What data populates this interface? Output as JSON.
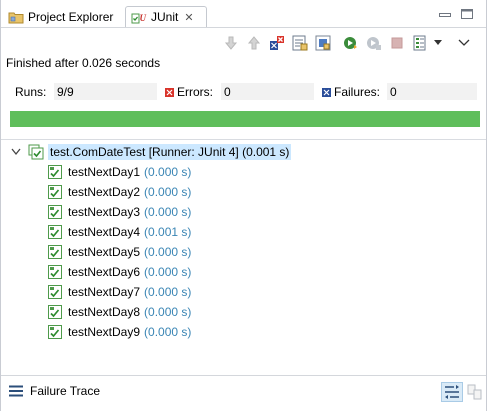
{
  "tabs": [
    {
      "label": "Project Explorer",
      "icon": "project-explorer-icon"
    },
    {
      "label": "JUnit",
      "icon": "junit-icon",
      "active": true
    }
  ],
  "toolbar": {
    "items": [
      "next-failure-icon",
      "previous-failure-icon",
      "show-failures-only-icon",
      "scroll-lock-icon",
      "show-skipped-icon",
      "rerun-test-icon",
      "rerun-failed-first-icon",
      "stop-icon",
      "test-run-history-icon",
      "view-menu-icon"
    ]
  },
  "status": "Finished after 0.026 seconds",
  "counters": {
    "runs_label": "Runs:",
    "runs_value": "9/9",
    "errors_label": "Errors:",
    "errors_value": "0",
    "failures_label": "Failures:",
    "failures_value": "0"
  },
  "progress": {
    "fraction": 1.0,
    "color": "#5fbe5b"
  },
  "tree": {
    "root": {
      "name": "test.ComDateTest [Runner: JUnit 4] (0.001 s)"
    },
    "items": [
      {
        "name": "testNextDay1",
        "time": "(0.000 s)"
      },
      {
        "name": "testNextDay2",
        "time": "(0.000 s)"
      },
      {
        "name": "testNextDay3",
        "time": "(0.000 s)"
      },
      {
        "name": "testNextDay4",
        "time": "(0.001 s)"
      },
      {
        "name": "testNextDay5",
        "time": "(0.000 s)"
      },
      {
        "name": "testNextDay6",
        "time": "(0.000 s)"
      },
      {
        "name": "testNextDay7",
        "time": "(0.000 s)"
      },
      {
        "name": "testNextDay8",
        "time": "(0.000 s)"
      },
      {
        "name": "testNextDay9",
        "time": "(0.000 s)"
      }
    ]
  },
  "footer": {
    "label": "Failure Trace"
  },
  "colors": {
    "accent_green": "#5fbe5b",
    "time_blue": "#3a85b4",
    "selection": "#cce8ff"
  }
}
